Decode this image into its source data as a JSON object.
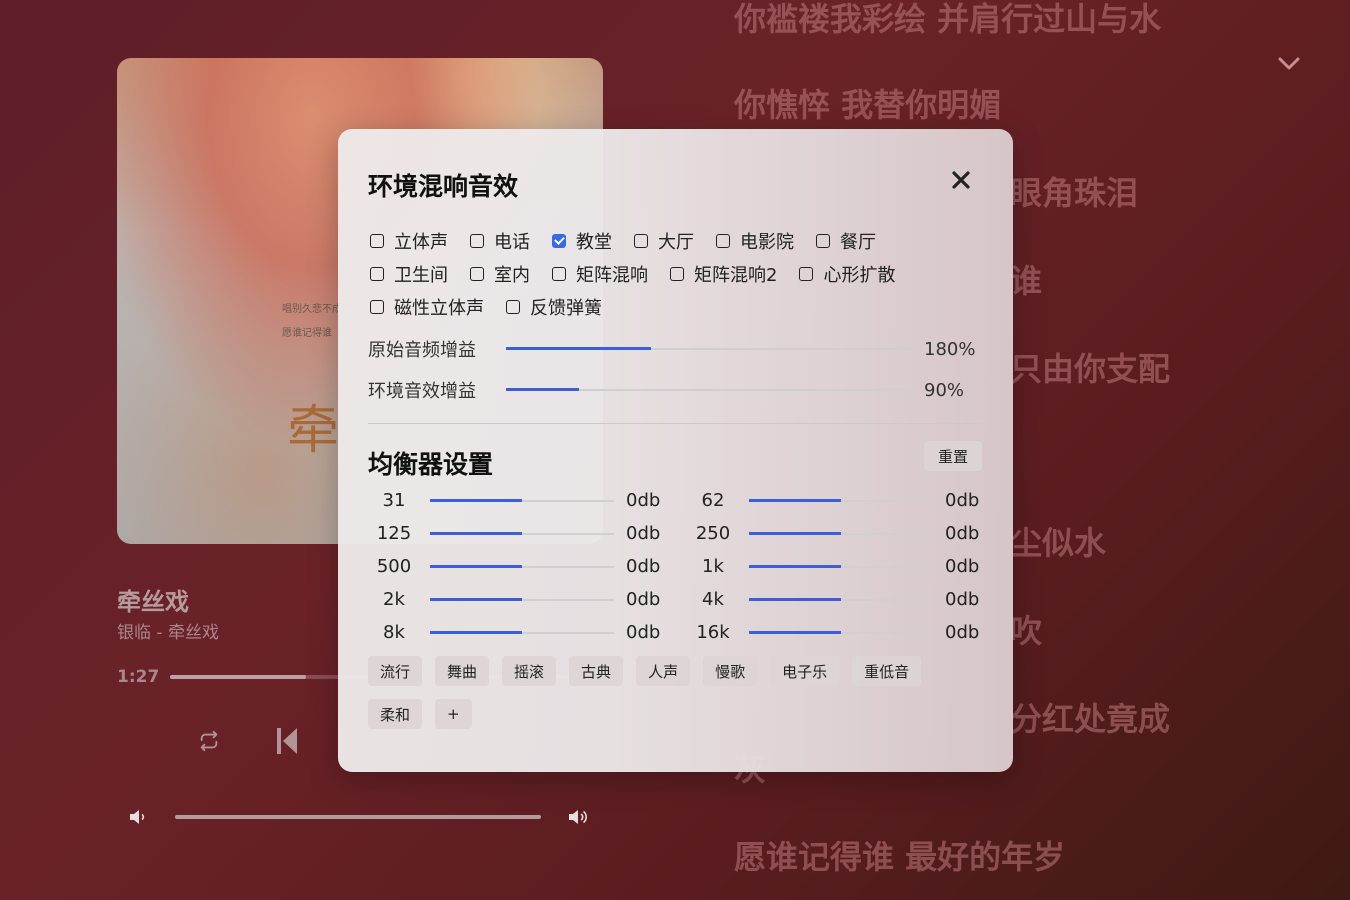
{
  "player": {
    "song_title": "牵丝戏",
    "song_artist": "银临 - 牵丝戏",
    "current_time": "1:27",
    "progress": 0.31,
    "album_art_text_1": "唱别久悲不成悲",
    "album_art_text_2": "愿谁记得谁",
    "album_art_calligraphy": "牵"
  },
  "lyrics": [
    "你褴褛我彩绘 并肩行过山与水",
    "你憔悴 我替你明媚",
    "眼角珠泪",
    "谁",
    "只由你支配",
    "尘似水",
    "吹",
    "分红处竟成",
    "灰",
    "愿谁记得谁 最好的年岁"
  ],
  "dialog": {
    "title": "环境混响音效",
    "effects": [
      {
        "label": "立体声",
        "checked": false
      },
      {
        "label": "电话",
        "checked": false
      },
      {
        "label": "教堂",
        "checked": true
      },
      {
        "label": "大厅",
        "checked": false
      },
      {
        "label": "电影院",
        "checked": false
      },
      {
        "label": "餐厅",
        "checked": false
      },
      {
        "label": "卫生间",
        "checked": false
      },
      {
        "label": "室内",
        "checked": false
      },
      {
        "label": "矩阵混响",
        "checked": false
      },
      {
        "label": "矩阵混响2",
        "checked": false
      },
      {
        "label": "心形扩散",
        "checked": false
      },
      {
        "label": "磁性立体声",
        "checked": false
      },
      {
        "label": "反馈弹簧",
        "checked": false
      }
    ],
    "original_gain": {
      "label": "原始音频增益",
      "value": "180%",
      "fraction": 0.36
    },
    "effect_gain": {
      "label": "环境音效增益",
      "value": "90%",
      "fraction": 0.18
    },
    "eq_title": "均衡器设置",
    "reset_label": "重置",
    "eq_bands": [
      {
        "freq": "31",
        "value": "0db",
        "fraction": 0.5
      },
      {
        "freq": "62",
        "value": "0db",
        "fraction": 0.5
      },
      {
        "freq": "125",
        "value": "0db",
        "fraction": 0.5
      },
      {
        "freq": "250",
        "value": "0db",
        "fraction": 0.5
      },
      {
        "freq": "500",
        "value": "0db",
        "fraction": 0.5
      },
      {
        "freq": "1k",
        "value": "0db",
        "fraction": 0.5
      },
      {
        "freq": "2k",
        "value": "0db",
        "fraction": 0.5
      },
      {
        "freq": "4k",
        "value": "0db",
        "fraction": 0.5
      },
      {
        "freq": "8k",
        "value": "0db",
        "fraction": 0.5
      },
      {
        "freq": "16k",
        "value": "0db",
        "fraction": 0.5
      }
    ],
    "presets": [
      "流行",
      "舞曲",
      "摇滚",
      "古典",
      "人声",
      "慢歌",
      "电子乐",
      "重低音",
      "柔和",
      "+"
    ]
  },
  "icons": {
    "close": "close-icon",
    "repeat": "repeat-icon",
    "previous": "previous-icon",
    "volume_low": "volume-low-icon",
    "volume_high": "volume-high-icon",
    "collapse": "chevron-down-icon"
  },
  "colors": {
    "accent": "#3b5fd9",
    "background": "#5e1e28"
  }
}
